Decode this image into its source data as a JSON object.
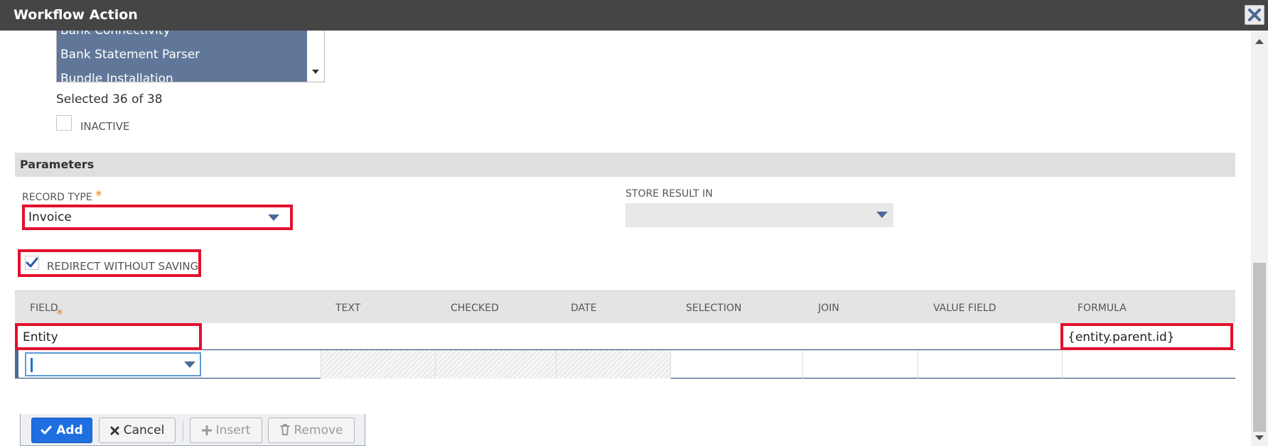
{
  "window": {
    "title": "Workflow Action",
    "close_icon": "close-icon"
  },
  "audience": {
    "items": [
      "Bank Connectivity",
      "Bank Statement Parser",
      "Bundle Installation"
    ],
    "selected_count": "Selected 36 of 38"
  },
  "inactive": {
    "label": "INACTIVE",
    "checked": false
  },
  "parameters": {
    "header": "Parameters",
    "record_type": {
      "label": "RECORD TYPE",
      "required_mark": "*",
      "value": "Invoice"
    },
    "store_result": {
      "label": "STORE RESULT IN",
      "value": ""
    },
    "redirect": {
      "label": "REDIRECT WITHOUT SAVING",
      "checked": true
    }
  },
  "grid": {
    "columns": [
      "FIELD",
      "TEXT",
      "CHECKED",
      "DATE",
      "SELECTION",
      "JOIN",
      "VALUE FIELD",
      "FORMULA"
    ],
    "field_required_mark": "*",
    "rows": [
      {
        "field": "Entity",
        "formula": "{entity.parent.id}"
      }
    ],
    "buttons": {
      "add": "Add",
      "cancel": "Cancel",
      "insert": "Insert",
      "remove": "Remove"
    }
  },
  "colors": {
    "title_bar": "#454545",
    "highlight_border": "#e3102c",
    "selected_list": "#607799",
    "primary_button": "#1f6fe0",
    "required": "#e08b2c"
  }
}
